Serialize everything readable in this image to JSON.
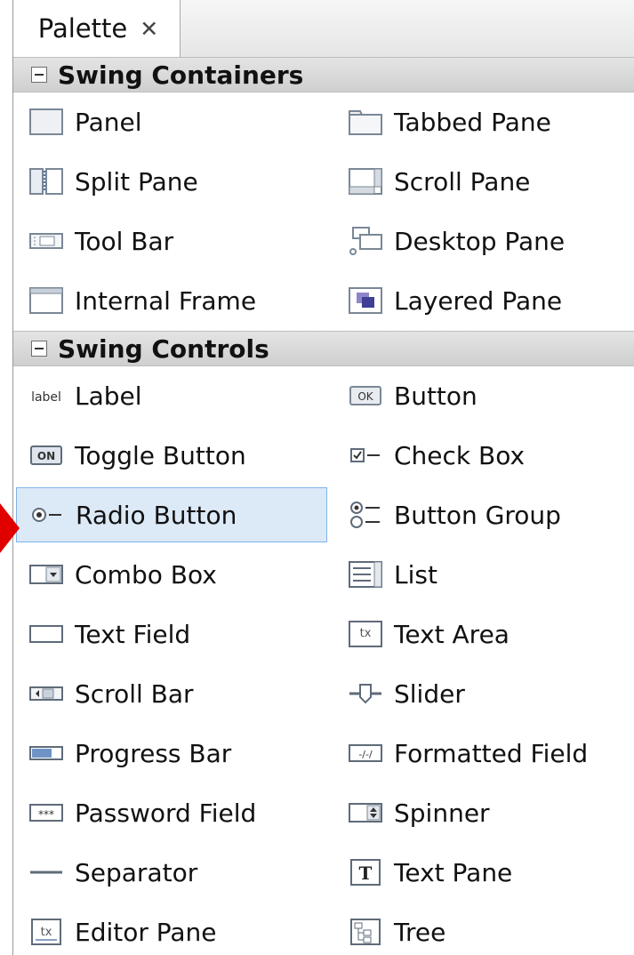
{
  "palette": {
    "tab_title": "Palette",
    "tab_close": "✕",
    "categories": [
      {
        "label": "Swing Containers",
        "items": [
          {
            "label": "Panel",
            "icon": "panel-icon"
          },
          {
            "label": "Tabbed Pane",
            "icon": "tabbed-pane-icon"
          },
          {
            "label": "Split Pane",
            "icon": "split-pane-icon"
          },
          {
            "label": "Scroll Pane",
            "icon": "scroll-pane-icon"
          },
          {
            "label": "Tool Bar",
            "icon": "tool-bar-icon"
          },
          {
            "label": "Desktop Pane",
            "icon": "desktop-pane-icon"
          },
          {
            "label": "Internal Frame",
            "icon": "internal-frame-icon"
          },
          {
            "label": "Layered Pane",
            "icon": "layered-pane-icon"
          }
        ]
      },
      {
        "label": "Swing Controls",
        "items": [
          {
            "label": "Label",
            "icon": "label-icon",
            "icon_text": "label"
          },
          {
            "label": "Button",
            "icon": "button-icon",
            "icon_text": "OK"
          },
          {
            "label": "Toggle Button",
            "icon": "toggle-button-icon",
            "icon_text": "ON"
          },
          {
            "label": "Check Box",
            "icon": "check-box-icon"
          },
          {
            "label": "Radio Button",
            "icon": "radio-button-icon",
            "selected": true
          },
          {
            "label": "Button Group",
            "icon": "button-group-icon"
          },
          {
            "label": "Combo Box",
            "icon": "combo-box-icon"
          },
          {
            "label": "List",
            "icon": "list-icon"
          },
          {
            "label": "Text Field",
            "icon": "text-field-icon"
          },
          {
            "label": "Text Area",
            "icon": "text-area-icon",
            "icon_text": "tx"
          },
          {
            "label": "Scroll Bar",
            "icon": "scroll-bar-icon"
          },
          {
            "label": "Slider",
            "icon": "slider-icon"
          },
          {
            "label": "Progress Bar",
            "icon": "progress-bar-icon"
          },
          {
            "label": "Formatted Field",
            "icon": "formatted-field-icon",
            "icon_text": "-/-/"
          },
          {
            "label": "Password Field",
            "icon": "password-field-icon",
            "icon_text": "***"
          },
          {
            "label": "Spinner",
            "icon": "spinner-icon"
          },
          {
            "label": "Separator",
            "icon": "separator-icon"
          },
          {
            "label": "Text Pane",
            "icon": "text-pane-icon",
            "icon_text": "T"
          },
          {
            "label": "Editor Pane",
            "icon": "editor-pane-icon",
            "icon_text": "tx"
          },
          {
            "label": "Tree",
            "icon": "tree-icon"
          }
        ]
      }
    ]
  },
  "colors": {
    "selection_background": "#dce9f7",
    "selection_border": "#7eb4ea",
    "category_header": "#d8d8d8",
    "pointer_arrow": "#e00000"
  }
}
